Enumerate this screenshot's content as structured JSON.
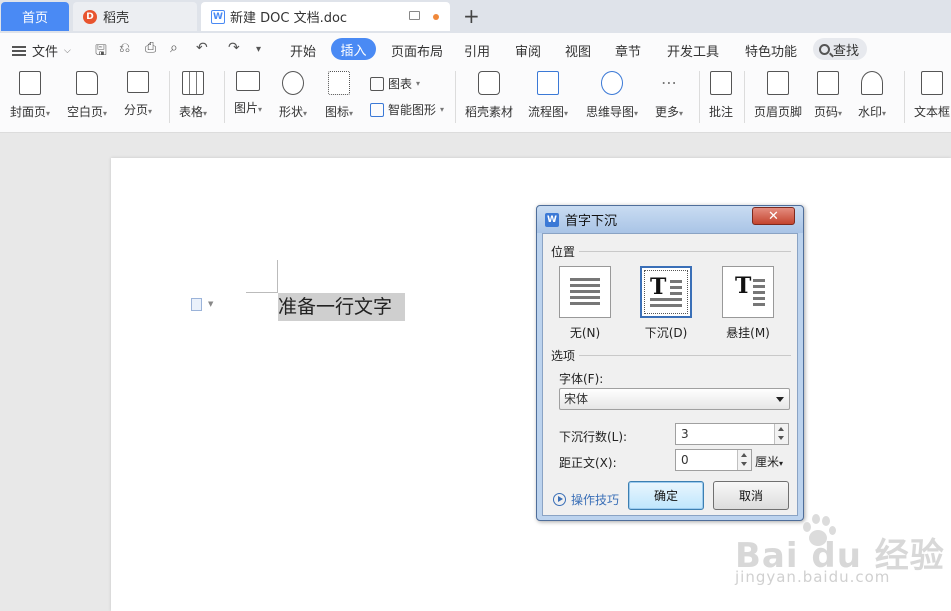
{
  "tabs": {
    "home": "首页",
    "daoke": "稻壳",
    "doc": "新建 DOC 文档.doc",
    "new_tab": "+"
  },
  "menu": {
    "file": "文件",
    "items": [
      "开始",
      "插入",
      "页面布局",
      "引用",
      "审阅",
      "视图",
      "章节",
      "开发工具",
      "特色功能"
    ],
    "active": "插入",
    "search": "查找"
  },
  "ribbon": {
    "tools": [
      {
        "label": "封面页",
        "icon": "cover-page-icon"
      },
      {
        "label": "空白页",
        "icon": "blank-page-icon"
      },
      {
        "label": "分页",
        "icon": "page-break-icon"
      },
      {
        "label": "表格",
        "icon": "table-icon"
      },
      {
        "label": "图片",
        "icon": "picture-icon"
      },
      {
        "label": "形状",
        "icon": "shape-icon"
      },
      {
        "label": "图标",
        "icon": "icons-icon"
      },
      {
        "label": "稻壳素材",
        "icon": "material-icon"
      },
      {
        "label": "流程图",
        "icon": "flowchart-icon"
      },
      {
        "label": "思维导图",
        "icon": "mindmap-icon"
      },
      {
        "label": "更多",
        "icon": "more-icon"
      },
      {
        "label": "批注",
        "icon": "comment-icon"
      },
      {
        "label": "页眉页脚",
        "icon": "header-footer-icon"
      },
      {
        "label": "页码",
        "icon": "page-number-icon"
      },
      {
        "label": "水印",
        "icon": "watermark-icon"
      },
      {
        "label": "文本框",
        "icon": "textbox-icon"
      }
    ],
    "chart": "图表",
    "smart_art": "智能图形"
  },
  "document": {
    "selected_text": "准备一行文字"
  },
  "dialog": {
    "title": "首字下沉",
    "position_group": "位置",
    "options": [
      {
        "label": "无(N)",
        "selected": false
      },
      {
        "label": "下沉(D)",
        "selected": true
      },
      {
        "label": "悬挂(M)",
        "selected": false
      }
    ],
    "options_group": "选项",
    "font_label": "字体(F):",
    "font_value": "宋体",
    "lines_label": "下沉行数(L):",
    "lines_value": "3",
    "distance_label": "距正文(X):",
    "distance_value": "0",
    "distance_unit": "厘米",
    "tips": "操作技巧",
    "ok": "确定",
    "cancel": "取消"
  },
  "watermark": {
    "brand": "Bai du 经验",
    "url": "jingyan.baidu.com"
  },
  "colors": {
    "accent": "#4a8af4",
    "dialog_frame": "#bcd3ee",
    "close_red": "#c4452f"
  }
}
